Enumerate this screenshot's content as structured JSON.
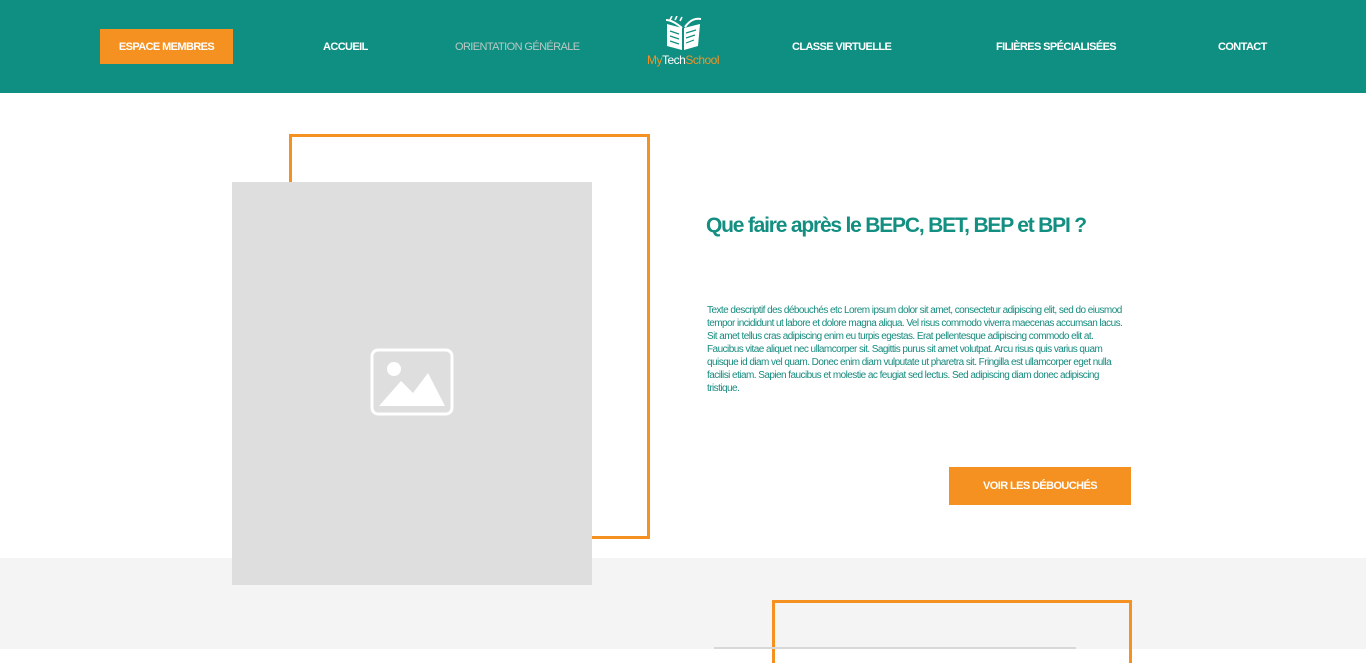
{
  "colors": {
    "header": "#0f8f82",
    "accent": "#f59120",
    "title": "#138f82",
    "text": "#168b7f",
    "placeholder": "#dedede",
    "section_two_background": "#f4f4f4"
  },
  "header": {
    "members_button": "ESPACE MEMBRES",
    "nav": {
      "accueil": "ACCUEIL",
      "orientation": "ORIENTATION GÉNÉRALE",
      "classe": "CLASSE VIRTUELLE",
      "filieres": "FILIÈRES SPÉCIALISÉES",
      "contact": "CONTACT"
    },
    "logo": {
      "my": "My",
      "tech": "Tech",
      "school": "School",
      "icon": "open-book-icon"
    }
  },
  "section_one": {
    "title": "Que faire après le BEPC, BET, BEP et BPI ?",
    "body": "Texte descriptif des débouchés etc Lorem ipsum dolor sit amet, consectetur adipiscing elit, sed do eiusmod tempor incididunt ut labore et dolore magna aliqua. Vel risus commodo viverra maecenas accumsan lacus. Sit amet tellus cras adipiscing enim eu turpis egestas. Erat pellentesque adipiscing commodo elit at. Faucibus vitae aliquet nec ullamcorper sit. Sagittis purus sit amet volutpat. Arcu risus quis varius quam quisque id diam vel quam. Donec enim diam vulputate ut pharetra sit. Fringilla est ullamcorper eget nulla facilisi etiam. Sapien faucibus et molestie ac feugiat sed lectus. Sed adipiscing diam donec adipiscing tristique.",
    "button": "VOIR LES DÉBOUCHÉS",
    "image_icon": "image-placeholder-icon"
  }
}
